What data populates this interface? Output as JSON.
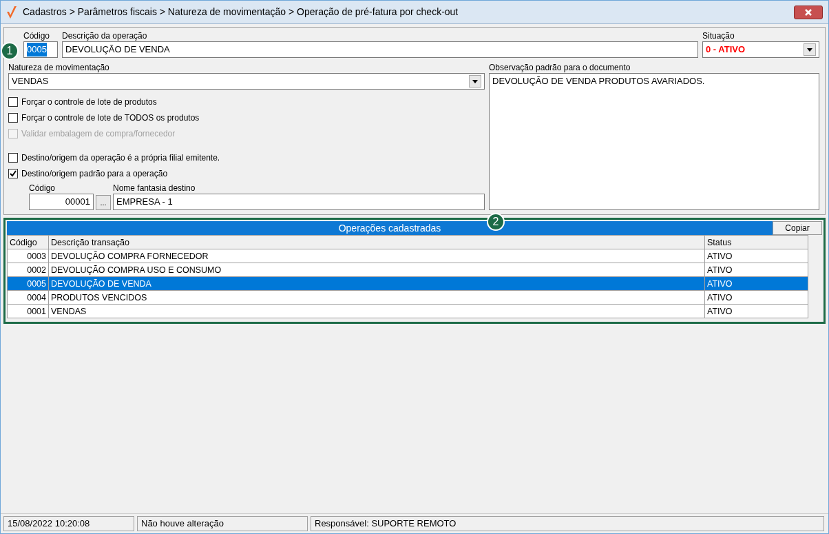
{
  "window": {
    "title": "Cadastros > Parâmetros fiscais > Natureza de movimentação > Operação de pré-fatura por check-out"
  },
  "form": {
    "code_label": "Código",
    "code_value": "0005",
    "description_label": "Descrição da operação",
    "description_value": "DEVOLUÇÃO DE VENDA",
    "situation_label": "Situação",
    "situation_value": "0 - ATIVO",
    "nature_label": "Natureza de movimentação",
    "nature_value": "VENDAS",
    "observation_label": "Observação padrão para o documento",
    "observation_value": "DEVOLUÇÃO DE VENDA PRODUTOS AVARIADOS."
  },
  "options": [
    {
      "label": "Forçar o controle de lote de produtos",
      "checked": false,
      "disabled": false
    },
    {
      "label": "Forçar o controle de lote de TODOS os produtos",
      "checked": false,
      "disabled": false
    },
    {
      "label": "Validar embalagem de compra/fornecedor",
      "checked": false,
      "disabled": true
    },
    {
      "label": "Destino/origem da operação é a própria filial emitente.",
      "checked": false,
      "disabled": false
    },
    {
      "label": "Destino/origem padrão para a operação",
      "checked": true,
      "disabled": false
    }
  ],
  "destination": {
    "code_label": "Código",
    "code_value": "00001",
    "browse_button": "...",
    "name_label": "Nome fantasia destino",
    "name_value": "EMPRESA - 1"
  },
  "grid": {
    "title": "Operações cadastradas",
    "copy_button": "Copiar",
    "columns": [
      "Código",
      "Descrição  transação",
      "Status"
    ],
    "rows": [
      {
        "cells": [
          "0003",
          "DEVOLUÇÃO COMPRA FORNECEDOR",
          "ATIVO"
        ],
        "selected": false
      },
      {
        "cells": [
          "0002",
          "DEVOLUÇÃO COMPRA USO E CONSUMO",
          "ATIVO"
        ],
        "selected": false
      },
      {
        "cells": [
          "0005",
          "DEVOLUÇÃO DE VENDA",
          "ATIVO"
        ],
        "selected": true
      },
      {
        "cells": [
          "0004",
          "PRODUTOS VENCIDOS",
          "ATIVO"
        ],
        "selected": false
      },
      {
        "cells": [
          "0001",
          "VENDAS",
          "ATIVO"
        ],
        "selected": false
      }
    ]
  },
  "callouts": [
    "1",
    "2"
  ],
  "status_bar": [
    "15/08/2022 10:20:08",
    "Não houve alteração",
    "Responsável: SUPORTE REMOTO"
  ]
}
